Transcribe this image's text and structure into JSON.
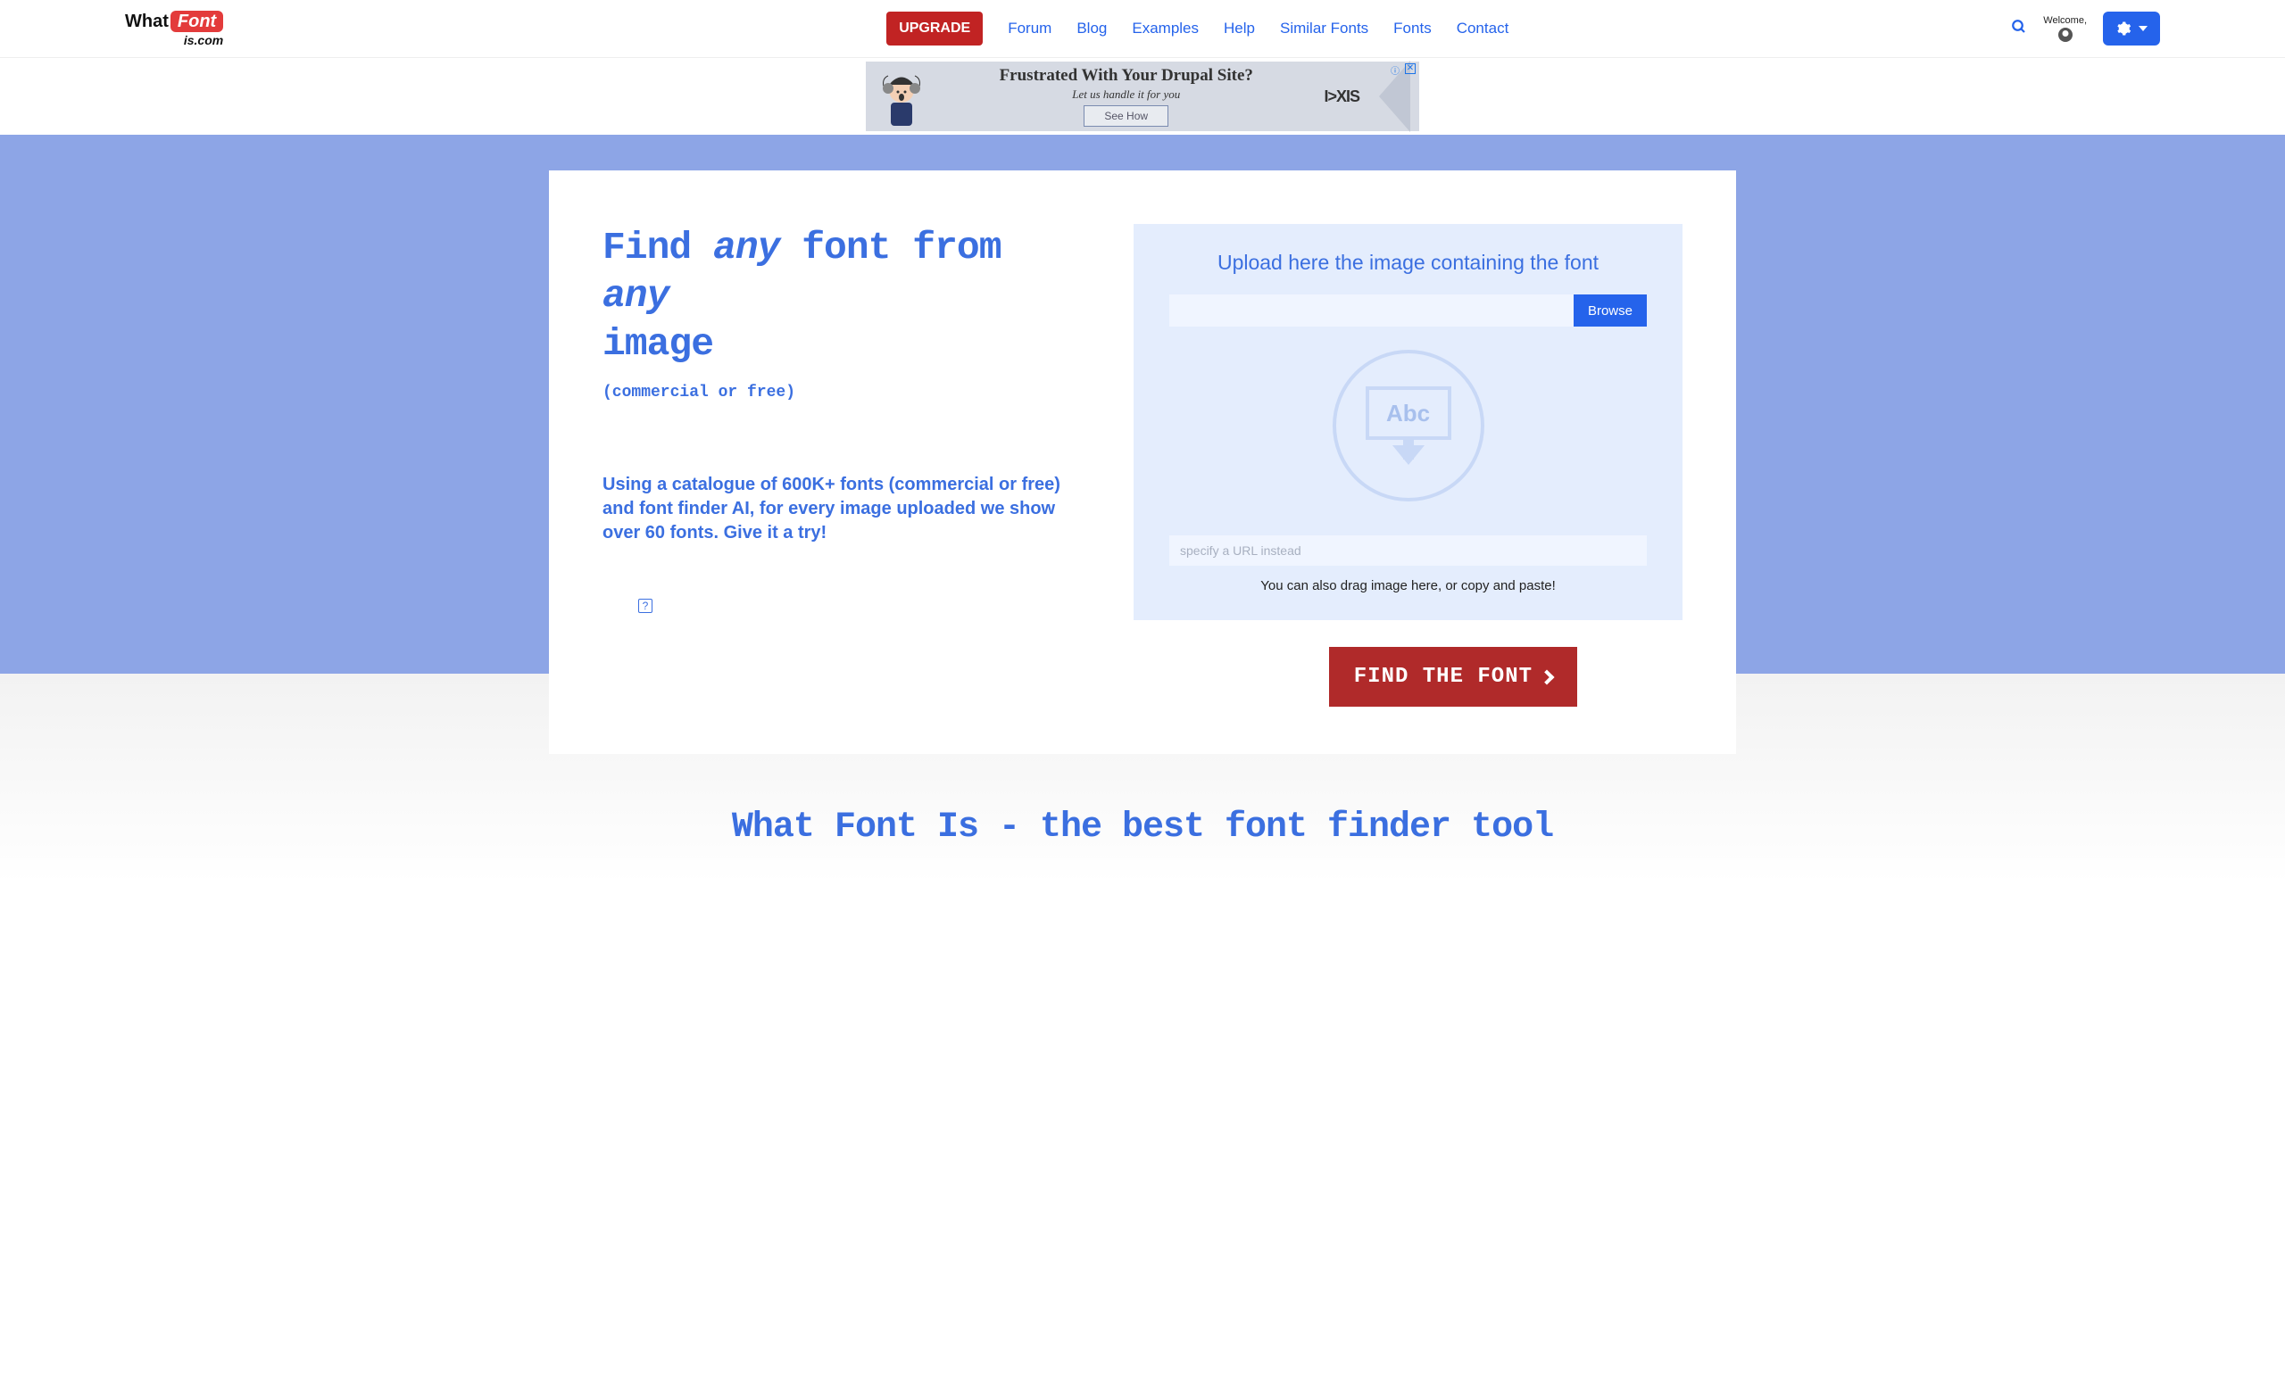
{
  "header": {
    "logo_what": "What",
    "logo_font": "Font",
    "logo_is": "is.com",
    "upgrade": "UPGRADE",
    "nav": [
      "Forum",
      "Blog",
      "Examples",
      "Help",
      "Similar Fonts",
      "Fonts",
      "Contact"
    ],
    "welcome": "Welcome,"
  },
  "ad": {
    "headline": "Frustrated With Your Drupal Site?",
    "sub": "Let us handle it for you",
    "cta": "See How",
    "brand": "I>XIS"
  },
  "hero": {
    "title_1": "Find ",
    "title_any1": "any",
    "title_2": " font from ",
    "title_any2": "any",
    "title_3": " image",
    "subtitle": "(commercial or free)",
    "desc": "Using a catalogue of 600K+ fonts (commercial or free) and font finder AI, for every image uploaded we show over 60 fonts. Give it a try!",
    "upload_title": "Upload here the image containing the font",
    "browse": "Browse",
    "abc": "Abc",
    "url_placeholder": "specify a URL instead",
    "drag_hint": "You can also drag image here, or copy and paste!",
    "find_button": "FIND THE FONT"
  },
  "tagline": "What Font Is - the best font finder tool",
  "help_q": "?"
}
